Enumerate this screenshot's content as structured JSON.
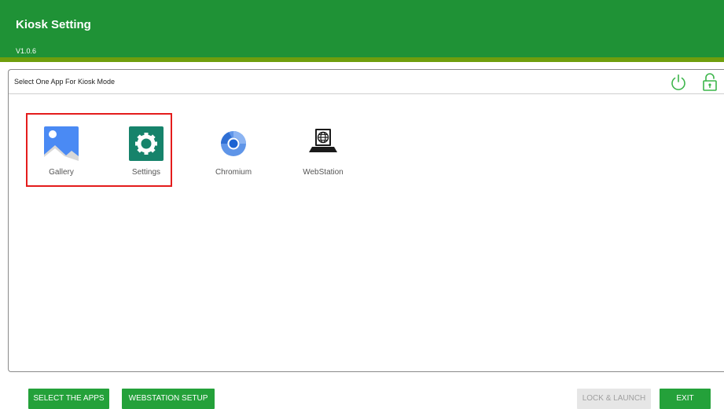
{
  "header": {
    "title": "Kiosk Setting",
    "version": "V1.0.6"
  },
  "panel": {
    "title": "Select One App For Kiosk Mode",
    "power_icon": "power-icon",
    "lock_icon": "lock-icon"
  },
  "apps": [
    {
      "label": "Gallery",
      "icon": "gallery-icon",
      "selected": true
    },
    {
      "label": "Settings",
      "icon": "settings-icon",
      "selected": true
    },
    {
      "label": "Chromium",
      "icon": "chromium-icon",
      "selected": false
    },
    {
      "label": "WebStation",
      "icon": "webstation-icon",
      "selected": false
    }
  ],
  "buttons": {
    "select_apps": "SELECT THE APPS",
    "webstation_setup": "WEBSTATION SETUP",
    "lock_launch": "LOCK & LAUNCH",
    "exit": "EXIT"
  },
  "colors": {
    "header": "#1f9236",
    "header_stripe": "#6f9e0d",
    "button": "#24a13a",
    "selection": "#e41c1c",
    "disabled_button": "#e6e6e6"
  }
}
